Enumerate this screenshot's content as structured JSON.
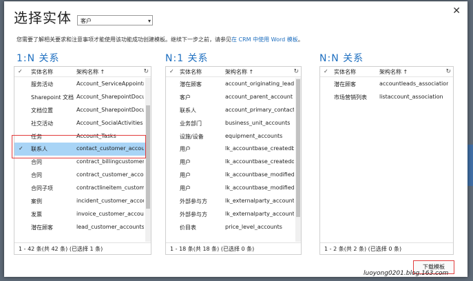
{
  "title": "选择实体",
  "entity_select": {
    "value": "客户"
  },
  "description": {
    "prefix": "您需要了解相关要求和注意事项才能使用该功能成功创建模板。继续下一步之前，请参见",
    "link": "在 CRM 中使用 Word 模板",
    "suffix": "。"
  },
  "columns": {
    "name": "实体名称",
    "schema": "架构名称 ↑"
  },
  "panel1": {
    "title": "1:N 关系",
    "footer": "1 - 42 条(共 42 条) (已选择 1 条)",
    "rows": [
      {
        "name": "服务活动",
        "schema": "Account_ServiceAppointment"
      },
      {
        "name": "Sharepoint 文档",
        "schema": "Account_SharepointDocument"
      },
      {
        "name": "文档位置",
        "schema": "Account_SharepointDocumentLoc"
      },
      {
        "name": "社交活动",
        "schema": "Account_SocialActivities"
      },
      {
        "name": "任务",
        "schema": "Account_Tasks"
      },
      {
        "name": "联系人",
        "schema": "contact_customer_accounts",
        "selected": true
      },
      {
        "name": "合同",
        "schema": "contract_billingcustomer_accou"
      },
      {
        "name": "合同",
        "schema": "contract_customer_accounts"
      },
      {
        "name": "合同子项",
        "schema": "contractlineitem_customer_acc"
      },
      {
        "name": "案例",
        "schema": "incident_customer_accounts"
      },
      {
        "name": "发票",
        "schema": "invoice_customer_accounts"
      },
      {
        "name": "潜在顾客",
        "schema": "lead_customer_accounts"
      }
    ]
  },
  "panel2": {
    "title": "N:1 关系",
    "footer": "1 - 18 条(共 18 条) (已选择 0 条)",
    "rows": [
      {
        "name": "潜在顾客",
        "schema": "account_originating_lead"
      },
      {
        "name": "客户",
        "schema": "account_parent_account"
      },
      {
        "name": "联系人",
        "schema": "account_primary_contact"
      },
      {
        "name": "业务部门",
        "schema": "business_unit_accounts"
      },
      {
        "name": "设施/设备",
        "schema": "equipment_accounts"
      },
      {
        "name": "用户",
        "schema": "lk_accountbase_createdby"
      },
      {
        "name": "用户",
        "schema": "lk_accountbase_createdonbehalf"
      },
      {
        "name": "用户",
        "schema": "lk_accountbase_modifiedby"
      },
      {
        "name": "用户",
        "schema": "lk_accountbase_modifiedonbeha"
      },
      {
        "name": "外部参与方",
        "schema": "lk_externalparty_account_createc"
      },
      {
        "name": "外部参与方",
        "schema": "lk_externalparty_account_modifie"
      },
      {
        "name": "价目表",
        "schema": "price_level_accounts"
      }
    ]
  },
  "panel3": {
    "title": "N:N 关系",
    "footer": "1 - 2 条(共 2 条) (已选择 0 条)",
    "rows": [
      {
        "name": "潜在顾客",
        "schema": "accountleads_association"
      },
      {
        "name": "市场营销列表",
        "schema": "listaccount_association"
      }
    ]
  },
  "download_button": "下载模板",
  "watermark": "luoyong0201.blog.163.com",
  "colors": {
    "accent": "#1e6fc0",
    "selection": "#a8d4f6",
    "highlight": "#e23b3b"
  }
}
